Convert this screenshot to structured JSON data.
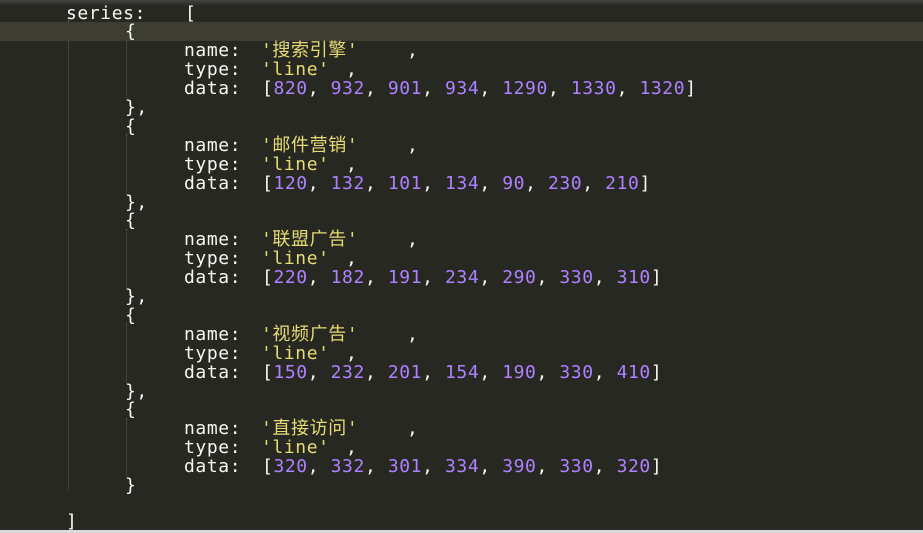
{
  "editor": {
    "series_key": "series:",
    "open_bracket": "[",
    "close_bracket": "]",
    "open_brace": "{",
    "close_brace": "}",
    "close_brace_comma": "},",
    "name_key": "name:",
    "type_key": "type:",
    "data_key": "data:",
    "items": [
      {
        "name": "'搜索引擎'",
        "type": "'line'",
        "data": [
          "820",
          "932",
          "901",
          "934",
          "1290",
          "1330",
          "1320"
        ]
      },
      {
        "name": "'邮件营销'",
        "type": "'line'",
        "data": [
          "120",
          "132",
          "101",
          "134",
          "90",
          "230",
          "210"
        ]
      },
      {
        "name": "'联盟广告'",
        "type": "'line'",
        "data": [
          "220",
          "182",
          "191",
          "234",
          "290",
          "330",
          "310"
        ]
      },
      {
        "name": "'视频广告'",
        "type": "'line'",
        "data": [
          "150",
          "232",
          "201",
          "154",
          "190",
          "330",
          "410"
        ]
      },
      {
        "name": "'直接访问'",
        "type": "'line'",
        "data": [
          "320",
          "332",
          "301",
          "334",
          "390",
          "330",
          "320"
        ]
      }
    ]
  },
  "colors": {
    "background": "#272822",
    "current_line": "#3e3d32",
    "text": "#f8f8f2",
    "string": "#e6db74",
    "number": "#ae81ff"
  }
}
